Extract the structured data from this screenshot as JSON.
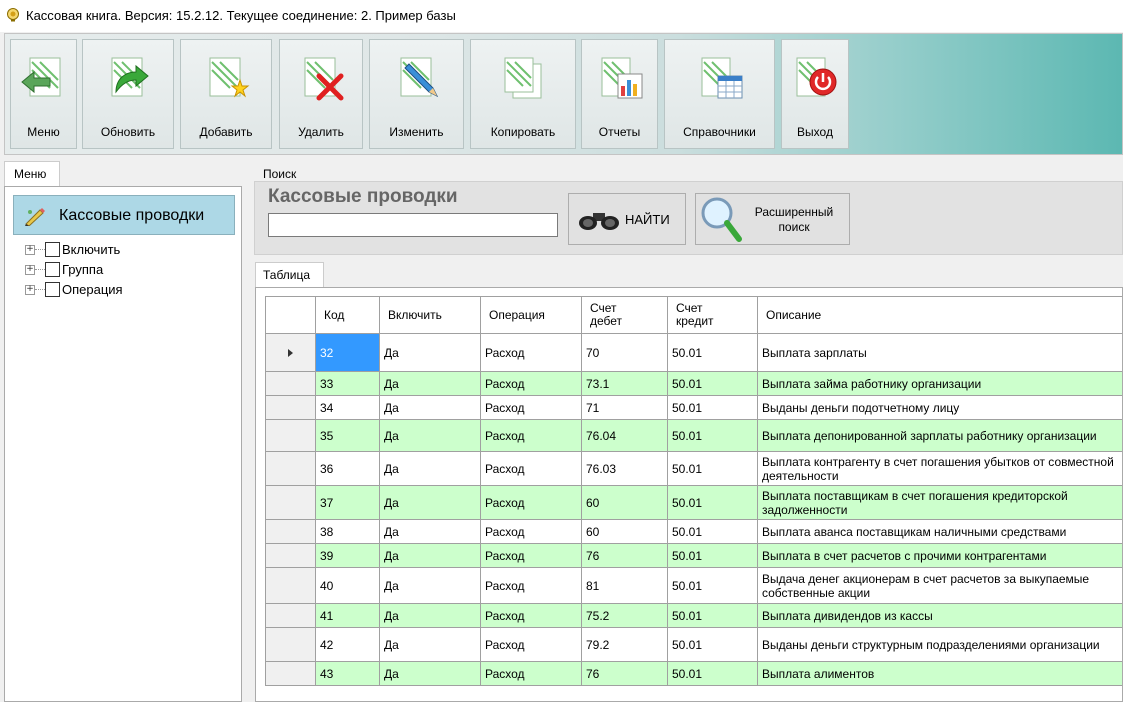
{
  "window": {
    "title": "Кассовая книга. Версия: 15.2.12. Текущее соединение: 2. Пример базы"
  },
  "toolbar": {
    "buttons": [
      {
        "label": "Меню",
        "icon": "back-arrow-icon"
      },
      {
        "label": "Обновить",
        "icon": "refresh-icon"
      },
      {
        "label": "Добавить",
        "icon": "add-document-icon"
      },
      {
        "label": "Удалить",
        "icon": "delete-document-icon"
      },
      {
        "label": "Изменить",
        "icon": "edit-document-icon"
      },
      {
        "label": "Копировать",
        "icon": "copy-document-icon"
      },
      {
        "label": "Отчеты",
        "icon": "report-chart-icon"
      },
      {
        "label": "Справочники",
        "icon": "reference-table-icon"
      },
      {
        "label": "Выход",
        "icon": "power-exit-icon"
      }
    ]
  },
  "menu": {
    "tab_label": "Меню",
    "header": "Кассовые проводки",
    "tree": [
      {
        "label": "Включить"
      },
      {
        "label": "Группа"
      },
      {
        "label": "Операция"
      }
    ]
  },
  "search": {
    "label": "Поиск",
    "title": "Кассовые проводки",
    "input_value": "",
    "find_label": "НАЙТИ",
    "advanced_line1": "Расширенный",
    "advanced_line2": "поиск"
  },
  "table": {
    "tab_label": "Таблица",
    "columns": {
      "code": "Код",
      "enable": "Включить",
      "operation": "Операция",
      "debit_1": "Счет",
      "debit_2": "дебет",
      "credit_1": "Счет",
      "credit_2": "кредит",
      "description": "Описание"
    },
    "rows": [
      {
        "code": "32",
        "enable": "Да",
        "operation": "Расход",
        "debit": "70",
        "credit": "50.01",
        "description": "Выплата зарплаты"
      },
      {
        "code": "33",
        "enable": "Да",
        "operation": "Расход",
        "debit": "73.1",
        "credit": "50.01",
        "description": "Выплата займа работнику организации"
      },
      {
        "code": "34",
        "enable": "Да",
        "operation": "Расход",
        "debit": "71",
        "credit": "50.01",
        "description": "Выданы деньги подотчетному лицу"
      },
      {
        "code": "35",
        "enable": "Да",
        "operation": "Расход",
        "debit": "76.04",
        "credit": "50.01",
        "description": "Выплата депонированной зарплаты работнику организации"
      },
      {
        "code": "36",
        "enable": "Да",
        "operation": "Расход",
        "debit": "76.03",
        "credit": "50.01",
        "description": "Выплата контрагенту в счет погашения убытков от совместной деятельности"
      },
      {
        "code": "37",
        "enable": "Да",
        "operation": "Расход",
        "debit": "60",
        "credit": "50.01",
        "description": "Выплата поставщикам в счет погашения кредиторской задолженности"
      },
      {
        "code": "38",
        "enable": "Да",
        "operation": "Расход",
        "debit": "60",
        "credit": "50.01",
        "description": "Выплата аванса поставщикам наличными средствами"
      },
      {
        "code": "39",
        "enable": "Да",
        "operation": "Расход",
        "debit": "76",
        "credit": "50.01",
        "description": "Выплата в счет расчетов с прочими контрагентами"
      },
      {
        "code": "40",
        "enable": "Да",
        "operation": "Расход",
        "debit": "81",
        "credit": "50.01",
        "description": "Выдача денег акционерам в счет расчетов за выкупаемые собственные акции"
      },
      {
        "code": "41",
        "enable": "Да",
        "operation": "Расход",
        "debit": "75.2",
        "credit": "50.01",
        "description": "Выплата дивидендов из кассы"
      },
      {
        "code": "42",
        "enable": "Да",
        "operation": "Расход",
        "debit": "79.2",
        "credit": "50.01",
        "description": "Выданы деньги структурным подразделениями организации"
      },
      {
        "code": "43",
        "enable": "Да",
        "operation": "Расход",
        "debit": "76",
        "credit": "50.01",
        "description": "Выплата алиментов"
      }
    ]
  },
  "colors": {
    "row_alt": "#ccffcc",
    "selection": "#3399ff",
    "menu_header": "#add8e6",
    "toolbar_accent": "#5cb8b2"
  }
}
